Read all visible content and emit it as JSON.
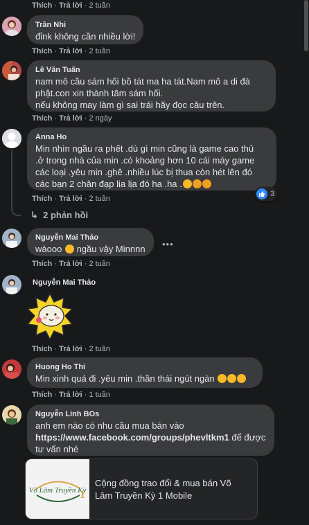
{
  "actions": {
    "like": "Thích",
    "reply": "Trả lời",
    "dot": "·"
  },
  "comments": [
    {
      "id": "c0",
      "time": "2 tuần"
    },
    {
      "id": "c1",
      "name": "Trần Nhi",
      "lines": [
        "đỉnk không cần nhiều lời!"
      ],
      "time": "2 tuần"
    },
    {
      "id": "c2",
      "name": "Lê Văn Tuấn",
      "lines": [
        "nam mô cầu sám hối bồ tát ma ha tát.Nam mô a di đà",
        "phật.con xin thành tâm sám hối.",
        "nếu không may làm gì sai trái hãy đọc câu trên."
      ],
      "time": "2 ngày"
    },
    {
      "id": "c3",
      "name": "Anna Ho",
      "lines": [
        "Min nhìn ngầu ra phết .dù gì min cũng là game cao thủ",
        ".ở trong nhà của min .có khoảng hơn 10 cái máy game",
        "các loại .yêu min .ghê .nhiều lúc bị thua còn hét lên đó",
        "các bạn 2 chân đạp lia lịa đó ha .ha ."
      ],
      "time": "2 tuần",
      "reaction_count": "3",
      "replies_label": "2 phản hồi"
    },
    {
      "id": "c4",
      "name": "Nguyễn Mai Thảo",
      "lines": [
        "wàooo",
        "ngầu vậy Minnnn"
      ],
      "time": "2 tuần",
      "more": "•••"
    },
    {
      "id": "c5",
      "name": "Nguyễn Mai Thảo",
      "time": "2 tuần",
      "sticker": "sticker-cute-face"
    },
    {
      "id": "c6",
      "name": "Huong Ho Thi",
      "lines": [
        "Min xinh quá đi .yêu min .thần thái ngút ngàn"
      ],
      "time": "1 tuần"
    },
    {
      "id": "c7",
      "name": "Nguyễn Linh BOs",
      "lines": [
        "anh em nào có nhu cầu mua bán vào",
        "https://www.facebook.com/groups/phevltkm1",
        "để được",
        "tư vấn nhé"
      ],
      "link_card": {
        "title_line1": "Cộng đồng trao đổi & mua bán Võ",
        "title_line2": "Lâm Truyền Kỳ 1 Mobile",
        "logo_text": "Võ Lâm Truyền Kỳ"
      }
    }
  ],
  "colors": {
    "background": "#18191a",
    "bubble": "#3a3b3c",
    "link_blue": "#2e89ff",
    "emoji_yellow": "#f7b928"
  }
}
